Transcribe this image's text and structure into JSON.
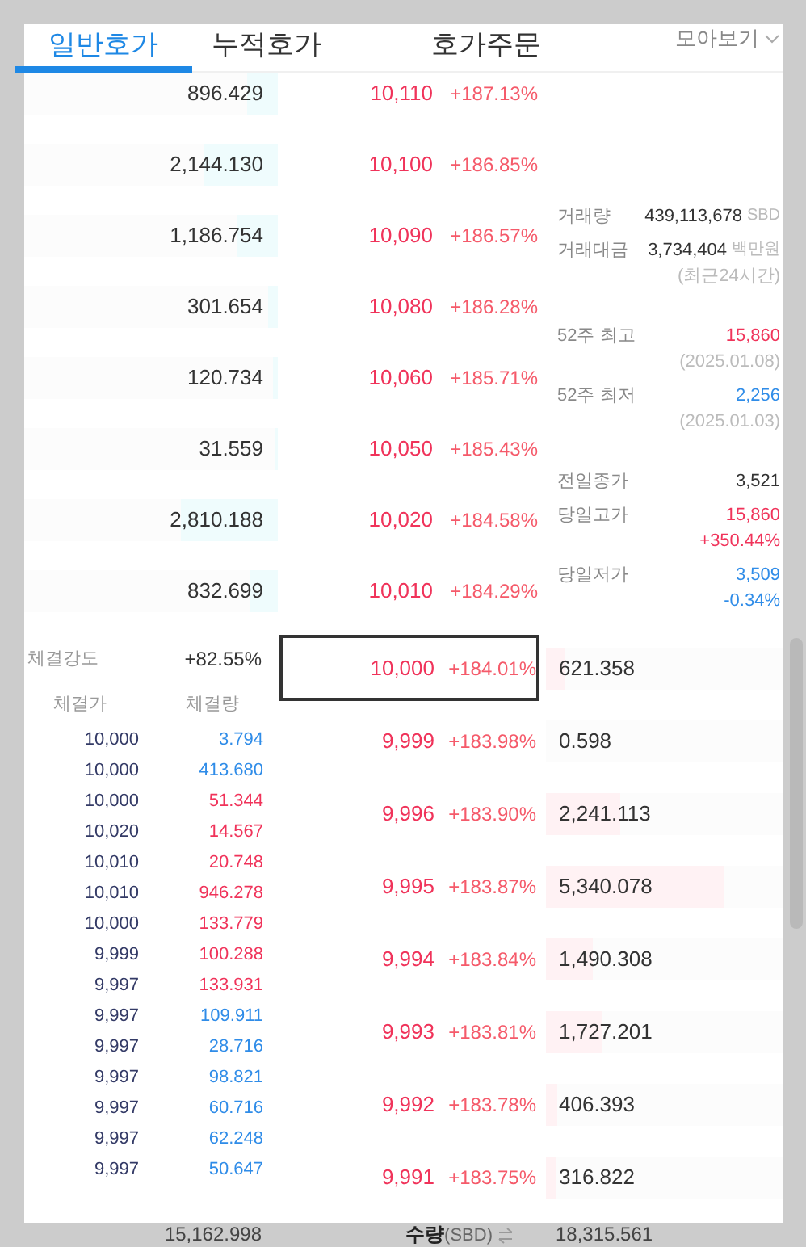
{
  "tabs": [
    {
      "label": "일반호가",
      "selected": true
    },
    {
      "label": "누적호가",
      "selected": false
    },
    {
      "label": "호가주문",
      "selected": false
    }
  ],
  "view_toggle": {
    "label": "모아보기"
  },
  "asks": [
    {
      "quantity": "896.429",
      "level": 0.12,
      "price": "10,110",
      "change": "+187.13%"
    },
    {
      "quantity": "2,144.130",
      "level": 0.29,
      "price": "10,100",
      "change": "+186.85%"
    },
    {
      "quantity": "1,186.754",
      "level": 0.16,
      "price": "10,090",
      "change": "+186.57%"
    },
    {
      "quantity": "301.654",
      "level": 0.04,
      "price": "10,080",
      "change": "+186.28%"
    },
    {
      "quantity": "120.734",
      "level": 0.02,
      "price": "10,060",
      "change": "+185.71%"
    },
    {
      "quantity": "31.559",
      "level": 0.01,
      "price": "10,050",
      "change": "+185.43%"
    },
    {
      "quantity": "2,810.188",
      "level": 0.38,
      "price": "10,020",
      "change": "+184.58%"
    },
    {
      "quantity": "832.699",
      "level": 0.11,
      "price": "10,010",
      "change": "+184.29%"
    }
  ],
  "market_info": [
    {
      "label": "거래량",
      "value": "439,113,678",
      "unit": "SBD",
      "color": "#333333"
    },
    {
      "label": "거래대금",
      "value": "3,734,404",
      "unit": "백만원",
      "note": "(최근24시간)",
      "color": "#333333"
    },
    {
      "label": "52주 최고",
      "value": "15,860",
      "note": "(2025.01.08)",
      "color": "#f0335a"
    },
    {
      "label": "52주 최저",
      "value": "2,256",
      "note": "(2025.01.03)",
      "color": "#2f8ce8"
    },
    {
      "label": "전일종가",
      "value": "3,521",
      "color": "#333333"
    },
    {
      "label": "당일고가",
      "value": "15,860",
      "change": "+350.44%",
      "color": "#f0335a"
    },
    {
      "label": "당일저가",
      "value": "3,509",
      "change": "-0.34%",
      "color": "#2f8ce8"
    }
  ],
  "trade_strength": {
    "label": "체결강도",
    "value": "+82.55%"
  },
  "trades": {
    "columns": [
      "체결가",
      "체결량"
    ],
    "rows": [
      {
        "price": "10,000",
        "volume": "3.794",
        "color": "#2f8ce8"
      },
      {
        "price": "10,000",
        "volume": "413.680",
        "color": "#2f8ce8"
      },
      {
        "price": "10,000",
        "volume": "51.344",
        "color": "#f0335a"
      },
      {
        "price": "10,020",
        "volume": "14.567",
        "color": "#f0335a"
      },
      {
        "price": "10,010",
        "volume": "20.748",
        "color": "#f0335a"
      },
      {
        "price": "10,010",
        "volume": "946.278",
        "color": "#f0335a"
      },
      {
        "price": "10,000",
        "volume": "133.779",
        "color": "#f0335a"
      },
      {
        "price": "9,999",
        "volume": "100.288",
        "color": "#f0335a"
      },
      {
        "price": "9,997",
        "volume": "133.931",
        "color": "#f0335a"
      },
      {
        "price": "9,997",
        "volume": "109.911",
        "color": "#2f8ce8"
      },
      {
        "price": "9,997",
        "volume": "28.716",
        "color": "#2f8ce8"
      },
      {
        "price": "9,997",
        "volume": "98.821",
        "color": "#2f8ce8"
      },
      {
        "price": "9,997",
        "volume": "60.716",
        "color": "#2f8ce8"
      },
      {
        "price": "9,997",
        "volume": "62.248",
        "color": "#2f8ce8"
      },
      {
        "price": "9,997",
        "volume": "50.647",
        "color": "#2f8ce8"
      }
    ]
  },
  "bids": [
    {
      "price": "10,000",
      "change": "+184.01%",
      "quantity": "621.358",
      "level": 0.08,
      "selected": true
    },
    {
      "price": "9,999",
      "change": "+183.98%",
      "quantity": "0.598",
      "level": 0,
      "selected": false
    },
    {
      "price": "9,996",
      "change": "+183.90%",
      "quantity": "2,241.113",
      "level": 0.31,
      "selected": false
    },
    {
      "price": "9,995",
      "change": "+183.87%",
      "quantity": "5,340.078",
      "level": 0.75,
      "selected": false
    },
    {
      "price": "9,994",
      "change": "+183.84%",
      "quantity": "1,490.308",
      "level": 0.2,
      "selected": false
    },
    {
      "price": "9,993",
      "change": "+183.81%",
      "quantity": "1,727.201",
      "level": 0.24,
      "selected": false
    },
    {
      "price": "9,992",
      "change": "+183.78%",
      "quantity": "406.393",
      "level": 0.05,
      "selected": false
    },
    {
      "price": "9,991",
      "change": "+183.75%",
      "quantity": "316.822",
      "level": 0.04,
      "selected": false
    }
  ],
  "footer": {
    "ask_total": "15,162.998",
    "unit_label": "수량",
    "unit": "(SBD)",
    "bid_total": "18,315.561"
  }
}
